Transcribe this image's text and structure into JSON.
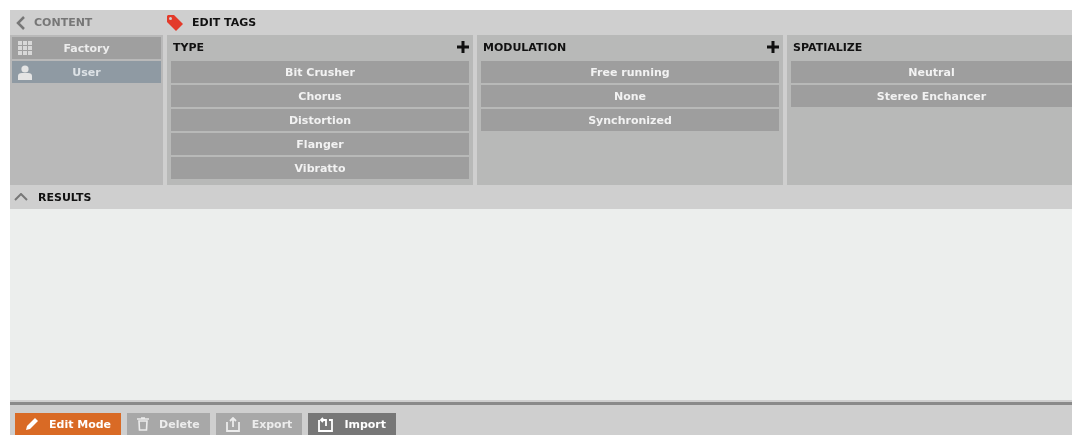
{
  "header": {
    "back_label": "CONTENT",
    "title": "EDIT TAGS"
  },
  "sources": [
    {
      "label": "Factory",
      "kind": "grid",
      "selected": false
    },
    {
      "label": "User",
      "kind": "user",
      "selected": true
    }
  ],
  "categories": [
    {
      "title": "TYPE",
      "can_add": true,
      "tags": [
        "Bit Crusher",
        "Chorus",
        "Distortion",
        "Flanger",
        "Vibratto"
      ]
    },
    {
      "title": "MODULATION",
      "can_add": true,
      "tags": [
        "Free running",
        "None",
        "Synchronized"
      ]
    },
    {
      "title": "SPATIALIZE",
      "can_add": false,
      "tags": [
        "Neutral",
        "Stereo Enchancer"
      ]
    }
  ],
  "results": {
    "label": "RESULTS",
    "expanded": true
  },
  "buttons": [
    {
      "label": "Edit Mode",
      "kind": "pencil",
      "selected": true,
      "disabled": false
    },
    {
      "label": "Delete",
      "kind": "trash",
      "selected": false,
      "disabled": true
    },
    {
      "label": "Export",
      "kind": "export",
      "selected": false,
      "disabled": true
    },
    {
      "label": "Import",
      "kind": "import",
      "selected": false,
      "disabled": false
    }
  ]
}
